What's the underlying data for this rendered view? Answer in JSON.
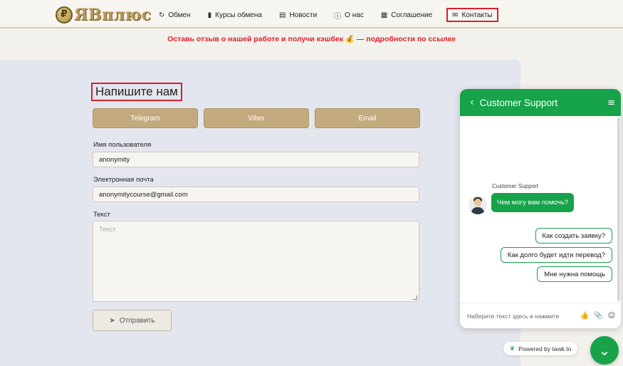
{
  "brand": {
    "logo_text": "ЯВплюс"
  },
  "nav": {
    "items": [
      {
        "label": "Обмен",
        "icon": "refresh-icon"
      },
      {
        "label": "Курсы обмена",
        "icon": "bar-chart-icon"
      },
      {
        "label": "Новости",
        "icon": "news-icon"
      },
      {
        "label": "О нас",
        "icon": "info-icon"
      },
      {
        "label": "Соглашение",
        "icon": "document-icon"
      },
      {
        "label": "Контакты",
        "icon": "mail-icon",
        "active": true
      }
    ]
  },
  "promo": {
    "text": "Оставь отзыв о нашей работе и получи кэшбек 💰 — подробности по ссылке"
  },
  "form": {
    "title": "Напишите нам",
    "tabs": [
      "Telegram",
      "Viber",
      "Email"
    ],
    "username_label": "Имя пользователя",
    "username_value": "anonymity",
    "email_label": "Электронная почта",
    "email_value": "anonymitycourse@gmail.com",
    "text_label": "Текст",
    "text_placeholder": "Текст",
    "submit_label": "Отправить"
  },
  "chat": {
    "title": "Customer Support",
    "agent_name": "Customer Support",
    "message": "Чем могу вам помочь?",
    "quick_replies": [
      "Как создать заявку?",
      "Как долго будет идти перевод?",
      "Мне нужна помощь"
    ],
    "input_placeholder": "Наберите текст здесь и нажмите",
    "powered_by": "Powered by tawk.to",
    "accent_color": "#16a34a"
  },
  "colors": {
    "brand_gold": "#c3aa7d",
    "highlight_red": "#d5222b"
  }
}
